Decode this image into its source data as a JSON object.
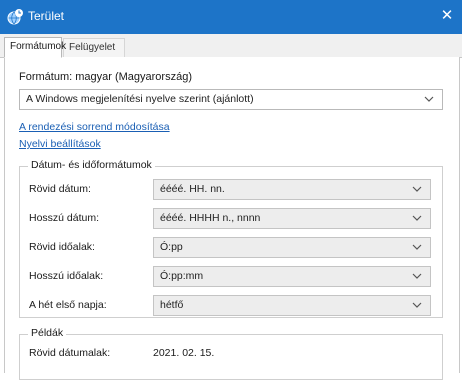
{
  "window": {
    "title": "Terület",
    "close_glyph": "✕",
    "accent_color": "#1d74c8"
  },
  "tabs": [
    {
      "label": "Formátumok"
    },
    {
      "label": "Felügyelet"
    }
  ],
  "formats": {
    "format_label": "Formátum: magyar (Magyarország)",
    "format_value": "A Windows megjelenítési nyelve szerint (ajánlott)",
    "sort_link": "A rendezési sorrend módosítása",
    "lang_link": "Nyelvi beállítások"
  },
  "datetime": {
    "legend": "Dátum- és időformátumok",
    "rows": [
      {
        "label": "Rövid dátum:",
        "value": "éééé. HH. nn."
      },
      {
        "label": "Hosszú dátum:",
        "value": "éééé. HHHH n., nnnn"
      },
      {
        "label": "Rövid időalak:",
        "value": "Ó:pp"
      },
      {
        "label": "Hosszú időalak:",
        "value": "Ó:pp:mm"
      },
      {
        "label": "A hét első napja:",
        "value": "hétfő"
      }
    ]
  },
  "examples": {
    "legend": "Példák",
    "short_date_label": "Rövid dátumalak:",
    "short_date_value": "2021. 02. 15."
  },
  "icons": {
    "window": "globe-clock-icon",
    "close": "close-icon",
    "dropdown": "chevron-down-icon"
  }
}
